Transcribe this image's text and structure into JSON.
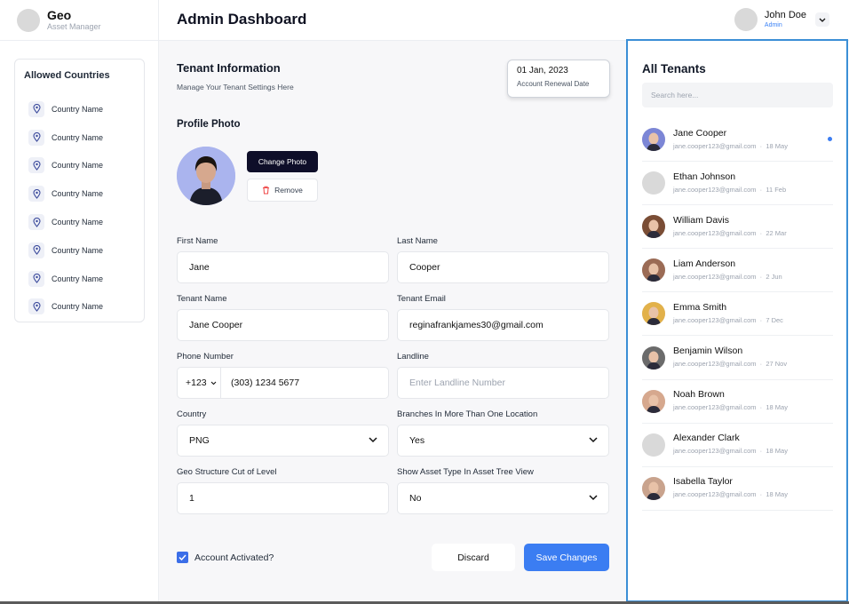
{
  "brand": {
    "title": "Geo",
    "subtitle": "Asset Manager"
  },
  "header": {
    "title": "Admin Dashboard"
  },
  "user": {
    "name": "John Doe",
    "role": "Admin"
  },
  "sidebar": {
    "title": "Allowed Countries",
    "items": [
      {
        "label": "Country Name",
        "icon": "location-pin-icon"
      },
      {
        "label": "Country Name",
        "icon": "location-pin-icon"
      },
      {
        "label": "Country Name",
        "icon": "location-pin-icon"
      },
      {
        "label": "Country Name",
        "icon": "location-pin-icon"
      },
      {
        "label": "Country Name",
        "icon": "location-pin-icon"
      },
      {
        "label": "Country Name",
        "icon": "location-pin-icon"
      },
      {
        "label": "Country Name",
        "icon": "location-pin-icon"
      },
      {
        "label": "Country Name",
        "icon": "location-pin-icon"
      }
    ]
  },
  "tenant_info": {
    "title": "Tenant Information",
    "subtitle": "Manage Your Tenant Settings Here",
    "renewal_date": "01 Jan, 2023",
    "renewal_label": "Account Renewal Date",
    "profile_photo_title": "Profile Photo",
    "change_photo_label": "Change Photo",
    "remove_label": "Remove"
  },
  "form": {
    "first_name": {
      "label": "First Name",
      "value": "Jane"
    },
    "last_name": {
      "label": "Last Name",
      "value": "Cooper"
    },
    "tenant_name": {
      "label": "Tenant Name",
      "value": "Jane Cooper"
    },
    "tenant_email": {
      "label": "Tenant Email",
      "value": "reginafrankjames30@gmail.com"
    },
    "phone": {
      "label": "Phone Number",
      "prefix": "+123",
      "value": "(303) 1234 5677"
    },
    "landline": {
      "label": "Landline",
      "placeholder": "Enter Landline Number"
    },
    "country": {
      "label": "Country",
      "value": "PNG"
    },
    "branches": {
      "label": "Branches In More Than One Location",
      "value": "Yes"
    },
    "geo_level": {
      "label": "Geo Structure Cut of Level",
      "value": "1"
    },
    "asset_type": {
      "label": "Show Asset Type In Asset Tree View",
      "value": "No"
    },
    "account_activated_label": "Account Activated?",
    "account_activated": true,
    "discard_label": "Discard",
    "save_label": "Save Changes"
  },
  "tenants": {
    "title": "All Tenants",
    "search_placeholder": "Search here...",
    "items": [
      {
        "name": "Jane Cooper",
        "email": "jane.cooper123@gmail.com",
        "date": "18 May",
        "unread": true
      },
      {
        "name": "Ethan Johnson",
        "email": "jane.cooper123@gmail.com",
        "date": "11 Feb"
      },
      {
        "name": "William Davis",
        "email": "jane.cooper123@gmail.com",
        "date": "22 Mar"
      },
      {
        "name": "Liam Anderson",
        "email": "jane.cooper123@gmail.com",
        "date": "2 Jun"
      },
      {
        "name": "Emma Smith",
        "email": "jane.cooper123@gmail.com",
        "date": "7 Dec"
      },
      {
        "name": "Benjamin Wilson",
        "email": "jane.cooper123@gmail.com",
        "date": "27 Nov"
      },
      {
        "name": "Noah Brown",
        "email": "jane.cooper123@gmail.com",
        "date": "18 May"
      },
      {
        "name": "Alexander Clark",
        "email": "jane.cooper123@gmail.com",
        "date": "18 May"
      },
      {
        "name": "Isabella Taylor",
        "email": "jane.cooper123@gmail.com",
        "date": "18 May"
      }
    ]
  },
  "colors": {
    "primary": "#3b7df2",
    "dark_button": "#0e0e29",
    "panel_border": "#3b8fd6",
    "main_bg": "#f7f7f9"
  }
}
